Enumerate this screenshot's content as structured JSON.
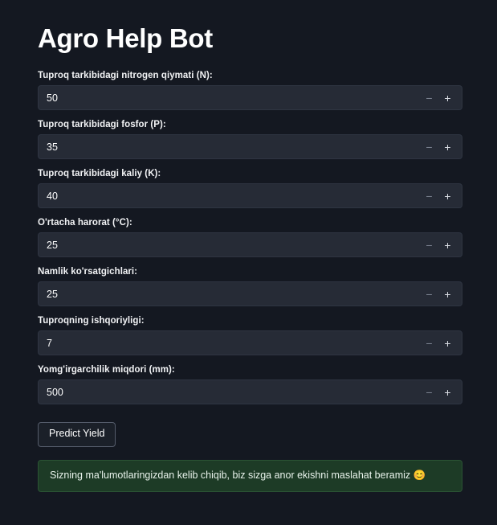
{
  "app": {
    "title": "Agro Help Bot",
    "background_color": "#141821"
  },
  "form": {
    "fields": [
      {
        "label": "Tuproq tarkibidagi nitrogen qiymati (N):",
        "value": "50",
        "name": "nitrogen"
      },
      {
        "label": "Tuproq tarkibidagi fosfor (P):",
        "value": "35",
        "name": "phosphorus"
      },
      {
        "label": "Tuproq tarkibidagi kaliy (K):",
        "value": "40",
        "name": "potassium"
      },
      {
        "label": "O'rtacha harorat (°C):",
        "value": "25",
        "name": "temperature"
      },
      {
        "label": "Namlik ko'rsatgichlari:",
        "value": "25",
        "name": "humidity"
      },
      {
        "label": "Tuproqning ishqoriyligi:",
        "value": "7",
        "name": "ph"
      },
      {
        "label": "Yomg'irgarchilik miqdori (mm):",
        "value": "500",
        "name": "rainfall"
      }
    ],
    "spinner": {
      "decrement_glyph": "−",
      "increment_glyph": "+"
    },
    "submit_label": "Predict Yield"
  },
  "result": {
    "message": "Sizning ma'lumotlaringizdan kelib chiqib, biz sizga anor ekishni maslahat beramiz",
    "emoji": "😊",
    "background_color": "#1d3b26"
  }
}
